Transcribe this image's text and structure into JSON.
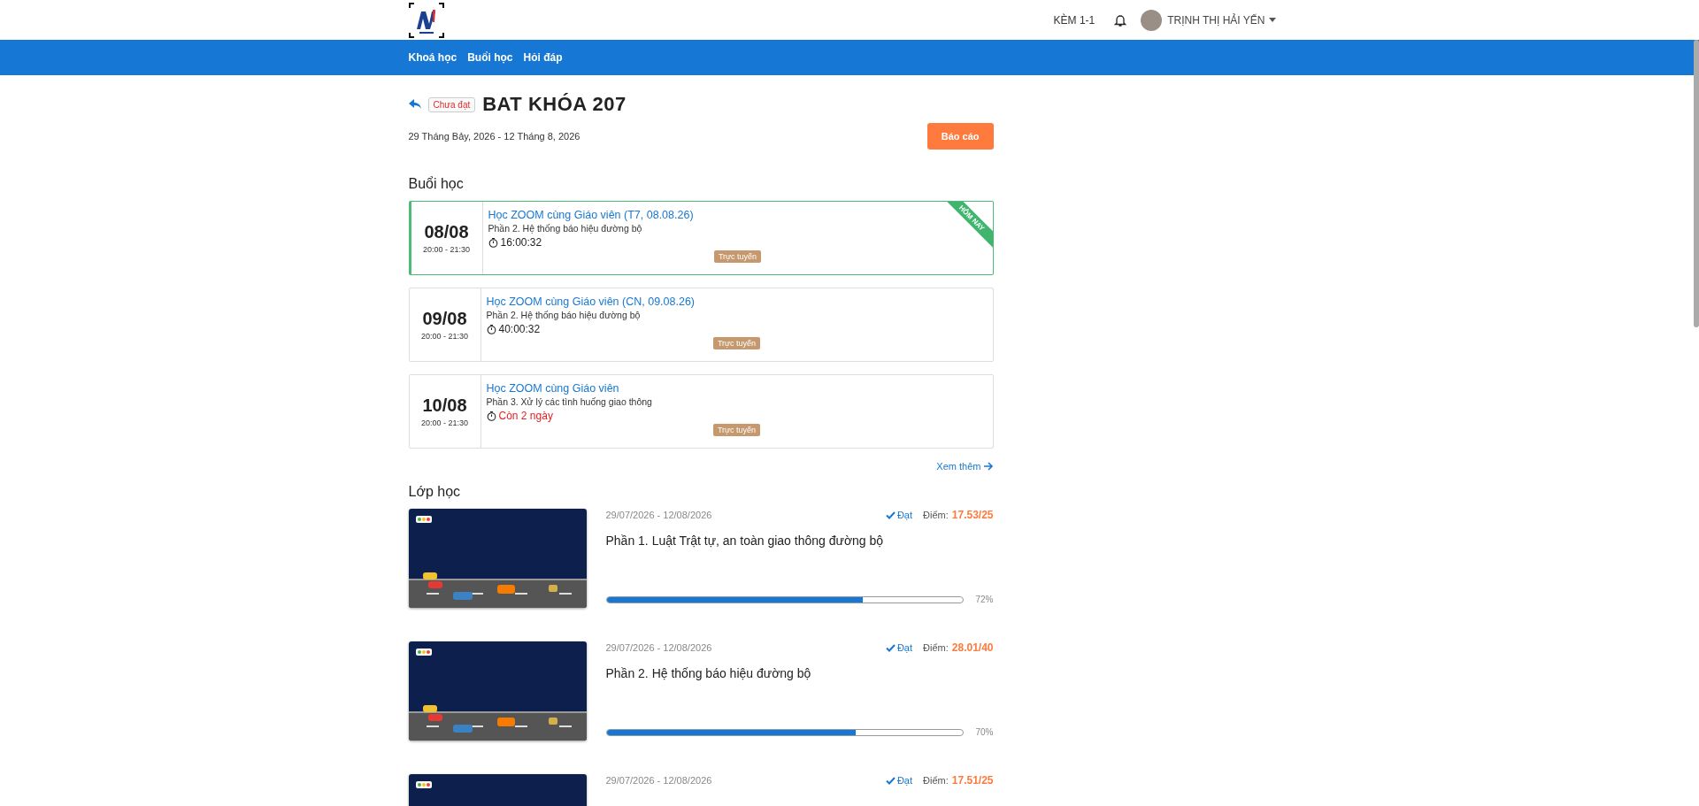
{
  "header": {
    "link": "KÈM 1-1",
    "user_name": "TRỊNH THỊ HẢI YẾN"
  },
  "nav": [
    {
      "label": "Khoá học"
    },
    {
      "label": "Buổi học"
    },
    {
      "label": "Hỏi đáp"
    }
  ],
  "course": {
    "status": "Chưa đạt",
    "title": "BAT KHÓA 207",
    "dates": "29 Tháng Bảy, 2026 - 12 Tháng 8, 2026",
    "report_button": "Báo cáo"
  },
  "sessions": {
    "heading": "Buổi học",
    "more_link": "Xem thêm",
    "items": [
      {
        "date": "08/08",
        "time": "20:00 - 21:30",
        "title": "Học ZOOM cùng Giáo viên (T7, 08.08.26)",
        "part": "Phần 2. Hệ thống báo hiệu đường bộ",
        "countdown": "16:00:32",
        "kind": "timer",
        "mode": "Trực tuyến",
        "today": true,
        "ribbon": "HÔM NAY"
      },
      {
        "date": "09/08",
        "time": "20:00 - 21:30",
        "title": "Học ZOOM cùng Giáo viên (CN, 09.08.26)",
        "part": "Phần 2. Hệ thống báo hiệu đường bộ",
        "countdown": "40:00:32",
        "kind": "timer",
        "mode": "Trực tuyến",
        "today": false
      },
      {
        "date": "10/08",
        "time": "20:00 - 21:30",
        "title": "Học ZOOM cùng Giáo viên",
        "part": "Phần 3. Xử lý các tình huống giao thông",
        "countdown": "Còn 2 ngày",
        "kind": "remaining",
        "mode": "Trực tuyến",
        "today": false
      }
    ]
  },
  "classes": {
    "heading": "Lớp học",
    "items": [
      {
        "dates": "29/07/2026 - 12/08/2026",
        "status": "Đạt",
        "score_label": "Điểm:",
        "score": "17.53/25",
        "title": "Phần 1. Luật Trật tự, an toàn giao thông đường bộ",
        "level": 0.72,
        "percent": "72%"
      },
      {
        "dates": "29/07/2026 - 12/08/2026",
        "status": "Đạt",
        "score_label": "Điểm:",
        "score": "28.01/40",
        "title": "Phần 2. Hệ thống báo hiệu đường bộ",
        "level": 0.7,
        "percent": "70%"
      },
      {
        "dates": "29/07/2026 - 12/08/2026",
        "status": "Đạt",
        "score_label": "Điểm:",
        "score": "17.51/25"
      }
    ]
  }
}
